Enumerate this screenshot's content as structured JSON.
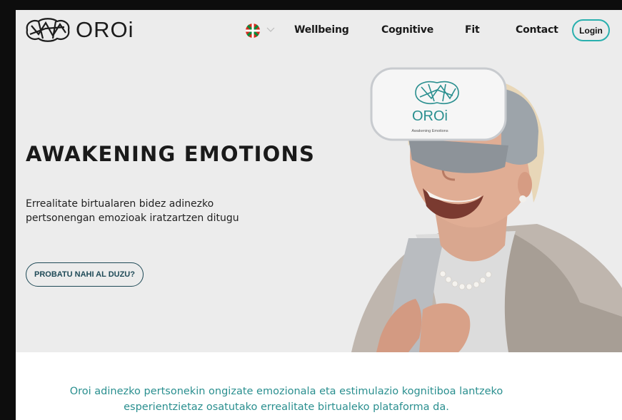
{
  "brand": {
    "name": "OROi",
    "accent_color": "#2ab0ae"
  },
  "nav": {
    "language_flag": "basque-flag-icon",
    "items": [
      {
        "label": "Wellbeing"
      },
      {
        "label": "Cognitive"
      },
      {
        "label": "Fit"
      },
      {
        "label": "Contact"
      }
    ],
    "login_label": "Login"
  },
  "hero": {
    "title": "AWAKENING EMOTIONS",
    "subtitle": "Errealitate birtualaren bidez adinezko pertsonengan emozioak iratzartzen ditugu",
    "cta_label": "PROBATU NAHI AL DUZU?",
    "headset_brand": "OROi",
    "headset_tagline": "Awakening Emotions"
  },
  "intro": {
    "text": "Oroi adinezko pertsonekin ongizate emozionala eta estimulazio kognitiboa lantzeko esperientzietaz osatutako errealitate birtualeko plataforma da."
  }
}
